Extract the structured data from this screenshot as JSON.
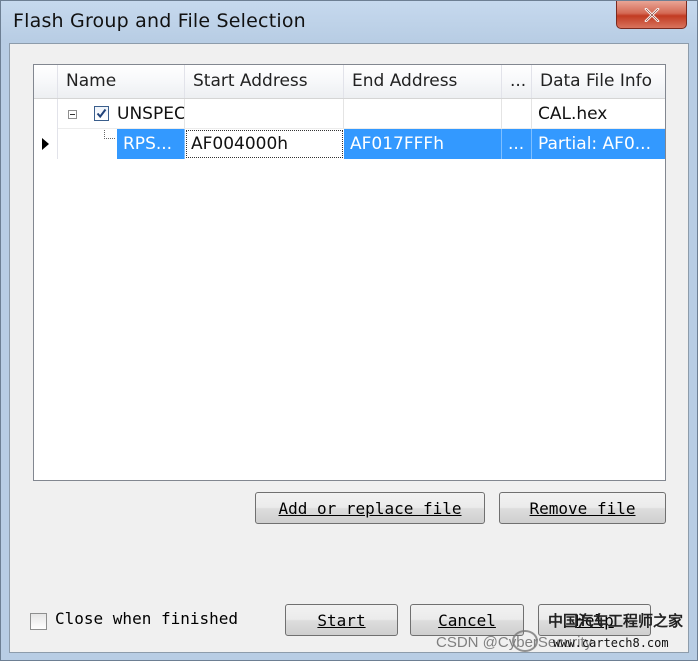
{
  "window": {
    "title": "Flash Group and File Selection"
  },
  "grid": {
    "columns": [
      "Name",
      "Start Address",
      "End Address",
      "...",
      "Data File Info"
    ],
    "rows": [
      {
        "name": "UNSPEC",
        "start": "",
        "end": "",
        "dots": "",
        "info": "CAL.hex",
        "checked": true
      },
      {
        "name": "RPS...",
        "start": "AF004000h",
        "end": "AF017FFFh",
        "dots": "...",
        "info": "Partial: AF0..."
      }
    ]
  },
  "buttons": {
    "add_replace": "Add or replace file",
    "remove": "Remove file",
    "start": "Start",
    "cancel": "Cancel",
    "help": "Help"
  },
  "close_when_finished": {
    "label": "Close when finished",
    "checked": false
  },
  "watermark": {
    "csdn": "CSDN @CyberSecurity",
    "site": "www.cartech8.com",
    "brand": "中国汽车工程师之家"
  },
  "colors": {
    "selection": "#3399ff",
    "close_button": "#c23b22"
  }
}
